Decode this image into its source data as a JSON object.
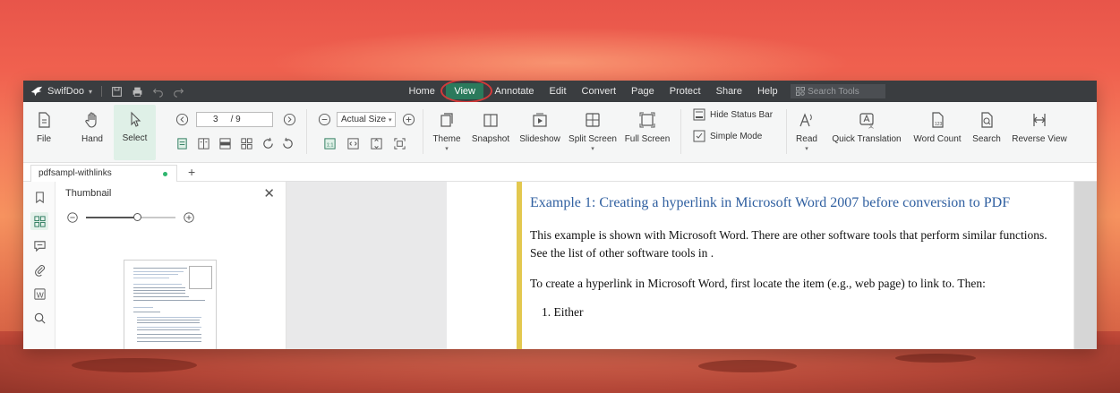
{
  "app": {
    "name": "SwifDoo",
    "menu": [
      "Home",
      "View",
      "Annotate",
      "Edit",
      "Convert",
      "Page",
      "Protect",
      "Share",
      "Help"
    ],
    "active_menu": "View",
    "search_placeholder": "Search Tools"
  },
  "ribbon": {
    "file": "File",
    "hand": "Hand",
    "select": "Select",
    "page_current": "3",
    "page_total": "/ 9",
    "zoom": "Actual Size",
    "theme": "Theme",
    "snapshot": "Snapshot",
    "slideshow": "Slideshow",
    "split_screen": "Split Screen",
    "full_screen": "Full Screen",
    "hide_status_bar": "Hide Status Bar",
    "simple_mode": "Simple Mode",
    "read": "Read",
    "quick_translation": "Quick Translation",
    "word_count": "Word Count",
    "search": "Search",
    "reverse_view": "Reverse View"
  },
  "tab": {
    "name": "pdfsampl-withlinks"
  },
  "thumbnail": {
    "title": "Thumbnail",
    "zoom_level": 0.57
  },
  "document": {
    "heading": "Example 1: Creating a hyperlink in Microsoft Word 2007 before conversion to PDF",
    "para1": "This example is shown with Microsoft Word. There are other software tools that perform similar functions. See the list of other software tools in .",
    "para2": "To create a hyperlink in Microsoft Word, first locate the item (e.g., web page) to link to. Then:",
    "list_item1": "1. Either"
  },
  "colors": {
    "accent": "#2b7a5c",
    "titlebar": "#3a3d40",
    "highlight_ring": "#d33a3a",
    "page_bar": "#e3c84f",
    "heading": "#2f5fa0"
  }
}
